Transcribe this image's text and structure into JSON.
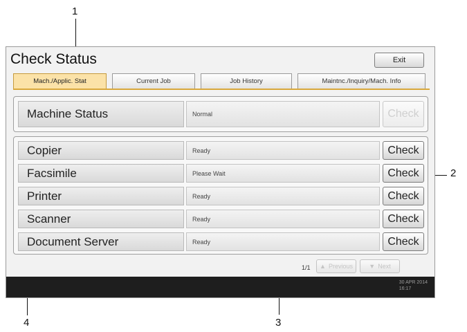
{
  "callouts": [
    "1",
    "2",
    "3",
    "4"
  ],
  "screen": {
    "title": "Check Status",
    "exit_label": "Exit",
    "tabs": [
      {
        "label": "Mach./Applic. Stat",
        "active": true
      },
      {
        "label": "Current Job",
        "active": false
      },
      {
        "label": "Job History",
        "active": false
      },
      {
        "label": "Maintnc./Inquiry/Mach. Info",
        "active": false
      }
    ],
    "machine_row": {
      "name": "Machine Status",
      "status": "Normal",
      "check_label": "Check",
      "check_enabled": false
    },
    "device_rows": [
      {
        "name": "Copier",
        "status": "Ready",
        "check_label": "Check"
      },
      {
        "name": "Facsimile",
        "status": "Please Wait",
        "check_label": "Check"
      },
      {
        "name": "Printer",
        "status": "Ready",
        "check_label": "Check"
      },
      {
        "name": "Scanner",
        "status": "Ready",
        "check_label": "Check"
      },
      {
        "name": "Document Server",
        "status": "Ready",
        "check_label": "Check"
      }
    ],
    "page_indicator": "1/1",
    "prev_label": "Previous",
    "next_label": "Next",
    "clock": {
      "date": "30 APR  2014",
      "time": "16:17"
    }
  },
  "colors": {
    "active_tab": "#fbe2a8",
    "tab_underline": "#d9a83b",
    "status_bar": "#1e1e1e"
  }
}
